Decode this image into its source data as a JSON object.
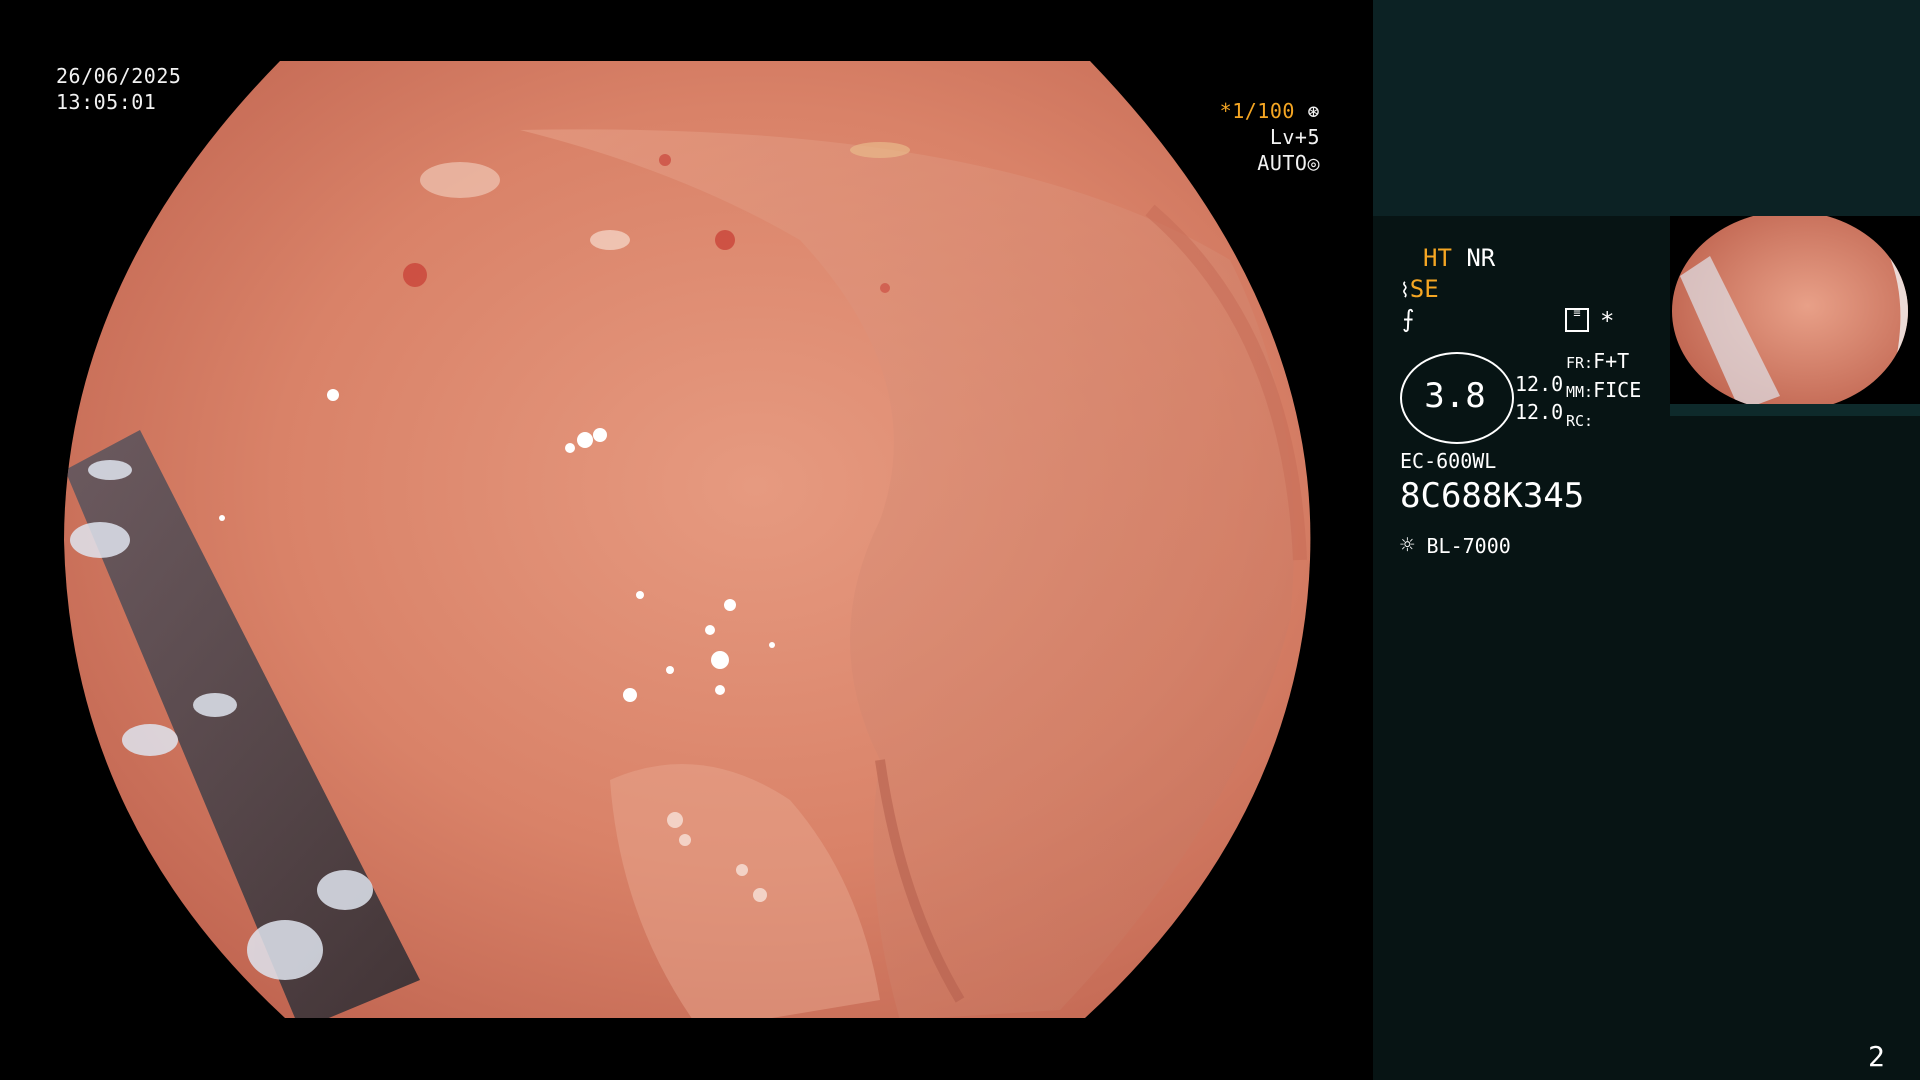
{
  "overlay": {
    "date": "26/06/2025",
    "time": "13:05:01",
    "shutter": "*1/100",
    "level": "Lv+5",
    "mode": "AUTO"
  },
  "panel": {
    "ht": "HT",
    "nr": "NR",
    "se": "SE",
    "circle_value": "3.8",
    "values": [
      "12.0",
      "12.0"
    ],
    "fr_label": "FR:",
    "fr_value": "F+T",
    "mm_label": "MM:",
    "mm_value": "FICE",
    "rc_label": "RC:",
    "scope_model": "EC-600WL",
    "serial": "8C688K345",
    "light_source": "BL-7000",
    "asterisk": "*"
  },
  "page_number": "2",
  "icons": [
    "aperture-icon",
    "iris-icon",
    "scope-icon",
    "freeze-icon",
    "settings-icon",
    "light-icon"
  ],
  "colors": {
    "tissue": "#d9826a",
    "panel_bg": "#071414",
    "panel_top": "#0c2224",
    "accent": "#f5a623"
  }
}
